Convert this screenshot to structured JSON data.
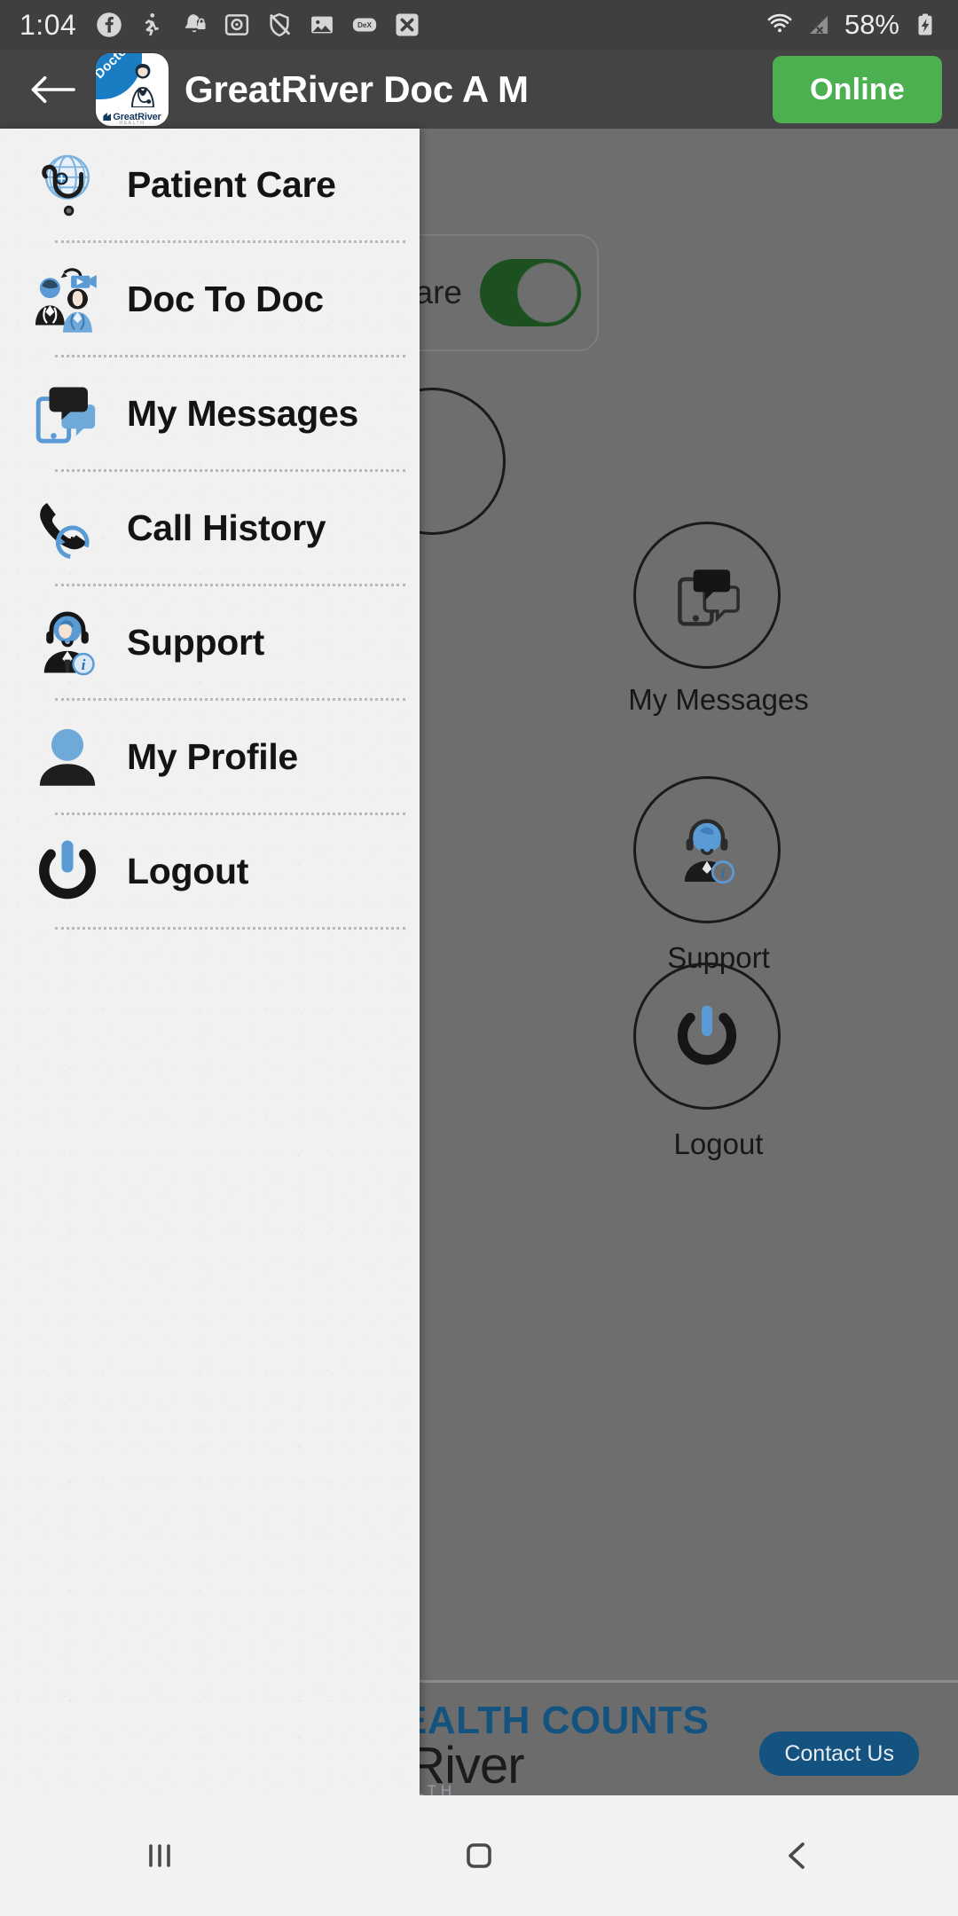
{
  "statusbar": {
    "clock": "1:04",
    "battery_percent": "58%",
    "icons": [
      "facebook-icon",
      "runner-icon",
      "bell-lock-icon",
      "safe-box-icon",
      "shield-off-icon",
      "photo-icon",
      "dex-icon",
      "close-icon"
    ],
    "dex_label": "DeX",
    "right_icons": [
      "wifi-icon",
      "cellular-no-signal-icon",
      "battery-charging-icon"
    ]
  },
  "appbar": {
    "back_label": "back-arrow",
    "title": "GreatRiver Doc A M",
    "logo": {
      "ribbon_text": "Doctor",
      "brand_text": "GreatRiver",
      "brand_sub": "HEALTH"
    },
    "status_button": "Online",
    "status_color": "#4cb050"
  },
  "drawer": {
    "items": [
      {
        "label": "Patient Care",
        "icon": "globe-stethoscope-icon"
      },
      {
        "label": "Doc To Doc",
        "icon": "two-doctors-video-icon"
      },
      {
        "label": "My Messages",
        "icon": "phone-chat-bubbles-icon"
      },
      {
        "label": "Call History",
        "icon": "phone-clock-history-icon"
      },
      {
        "label": "Support",
        "icon": "headset-agent-info-icon"
      },
      {
        "label": "My Profile",
        "icon": "user-avatar-icon"
      },
      {
        "label": "Logout",
        "icon": "power-off-icon"
      }
    ]
  },
  "main": {
    "toggle_card": {
      "label": "Care",
      "toggle_state": "on",
      "toggle_on_color": "#1d5021"
    },
    "tiles": [
      {
        "label": "My Messages",
        "icon": "phone-chat-bubbles-icon"
      },
      {
        "label": "Support",
        "icon": "headset-agent-info-icon"
      },
      {
        "label": "Logout",
        "icon": "power-off-icon"
      }
    ],
    "banner": {
      "line1": "EALTH COUNTS",
      "line2": "t River",
      "line3": "ALTH",
      "contact_button": "Contact Us",
      "accent_color": "#14537f"
    }
  },
  "navbar": {
    "buttons": [
      "recents-icon",
      "home-icon",
      "back-icon"
    ]
  }
}
